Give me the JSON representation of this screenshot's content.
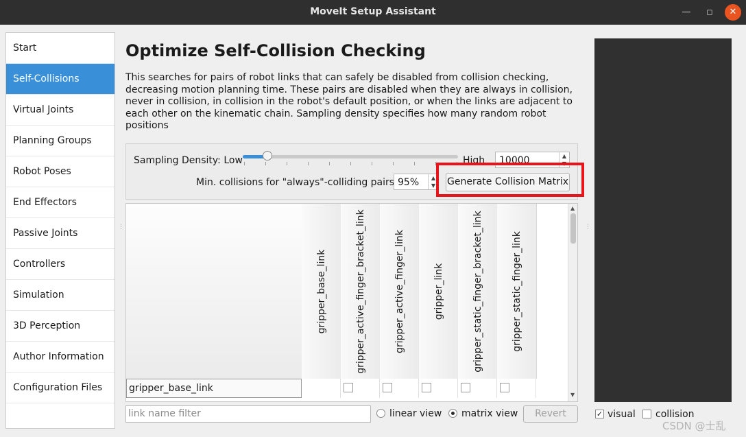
{
  "window": {
    "title": "MoveIt Setup Assistant"
  },
  "sidebar": {
    "items": [
      {
        "label": "Start"
      },
      {
        "label": "Self-Collisions",
        "active": true
      },
      {
        "label": "Virtual Joints"
      },
      {
        "label": "Planning Groups"
      },
      {
        "label": "Robot Poses"
      },
      {
        "label": "End Effectors"
      },
      {
        "label": "Passive Joints"
      },
      {
        "label": "Controllers"
      },
      {
        "label": "Simulation"
      },
      {
        "label": "3D Perception"
      },
      {
        "label": "Author Information"
      },
      {
        "label": "Configuration Files"
      }
    ]
  },
  "page": {
    "title": "Optimize Self-Collision Checking",
    "description": "This searches for pairs of robot links that can safely be disabled from collision checking,\ndecreasing motion planning time. These pairs are disabled when they are always in collision,\nnever in collision, in collision in the robot's default position, or when the links are adjacent to\neach other on the kinematic chain. Sampling density specifies how many random robot positions"
  },
  "controls": {
    "sampling_label": "Sampling Density: Low",
    "sampling_high": "High",
    "sampling_value": "10000",
    "sampling_fraction": 0.11,
    "min_collisions_label": "Min. collisions for \"always\"-colliding pairs:",
    "min_collisions_value": "95%",
    "generate_button": "Generate Collision Matrix"
  },
  "matrix": {
    "columns": [
      "gripper_base_link",
      "gripper_active_finger_bracket_link",
      "gripper_active_finger_link",
      "gripper_link",
      "gripper_static_finger_bracket_link",
      "gripper_static_finger_link"
    ],
    "rows": [
      {
        "label": "gripper_base_link"
      }
    ]
  },
  "bottom": {
    "filter_placeholder": "link name filter",
    "linear_view": "linear view",
    "matrix_view": "matrix view",
    "selected_view": "matrix view",
    "revert": "Revert"
  },
  "viewer": {
    "visual_label": "visual",
    "visual_checked": true,
    "collision_label": "collision",
    "collision_checked": false
  },
  "watermark": "CSDN @士乱"
}
